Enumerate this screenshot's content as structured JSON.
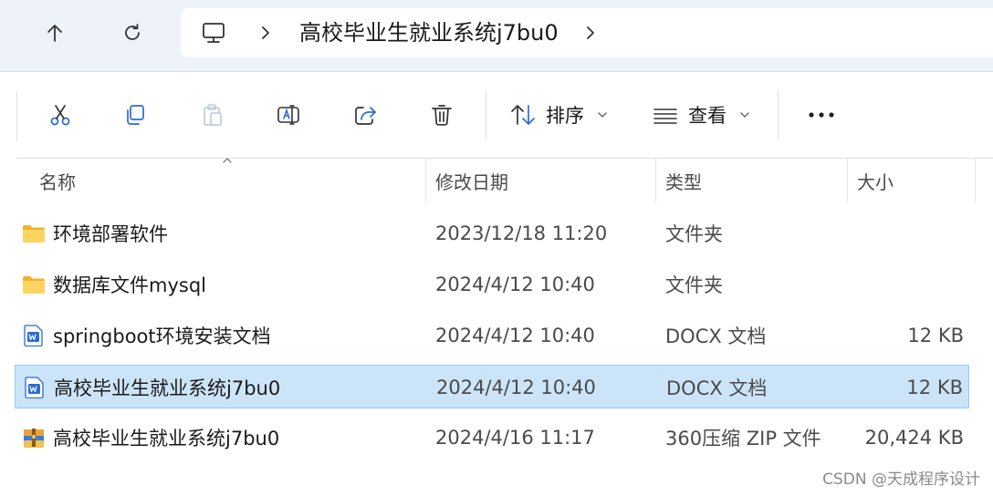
{
  "address_bar": {
    "breadcrumb": "高校毕业生就业系统j7bu0"
  },
  "toolbar": {
    "sort_label": "排序",
    "view_label": "查看"
  },
  "columns": {
    "name": "名称",
    "modified": "修改日期",
    "type": "类型",
    "size": "大小"
  },
  "files": [
    {
      "name": "环境部署软件",
      "modified": "2023/12/18 11:20",
      "type": "文件夹",
      "size": "",
      "icon": "folder-icon"
    },
    {
      "name": "数据库文件mysql",
      "modified": "2024/4/12 10:40",
      "type": "文件夹",
      "size": "",
      "icon": "folder-icon"
    },
    {
      "name": "springboot环境安装文档",
      "modified": "2024/4/12 10:40",
      "type": "DOCX 文档",
      "size": "12 KB",
      "icon": "docx-icon"
    },
    {
      "name": "高校毕业生就业系统j7bu0",
      "modified": "2024/4/12 10:40",
      "type": "DOCX 文档",
      "size": "12 KB",
      "icon": "docx-icon",
      "selected": true
    },
    {
      "name": "高校毕业生就业系统j7bu0",
      "modified": "2024/4/16 11:17",
      "type": "360压缩 ZIP 文件",
      "size": "20,424 KB",
      "icon": "zip-archive-icon"
    }
  ],
  "watermark": "CSDN @天成程序设计",
  "colors": {
    "selection": "#cce4f7",
    "folder": "#f4c542",
    "docx": "#2b6cd4"
  }
}
